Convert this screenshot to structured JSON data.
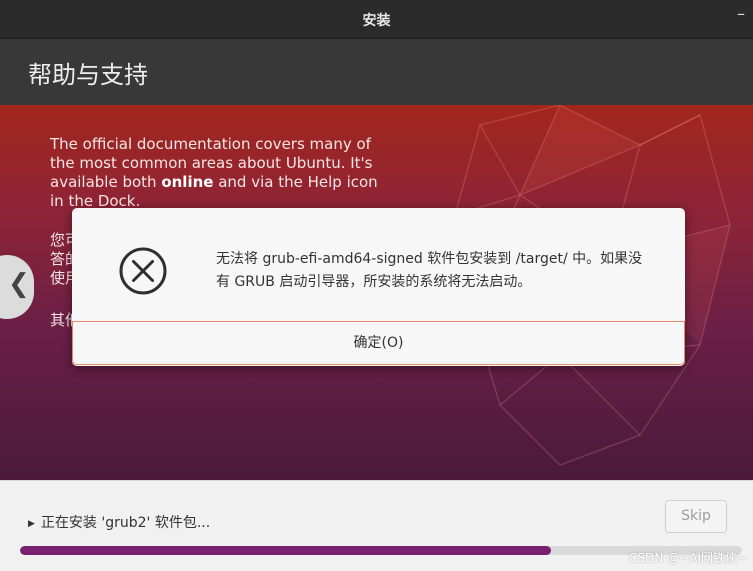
{
  "window": {
    "title": "安装",
    "minimize_glyph": "–"
  },
  "header": {
    "title": "帮助与支持"
  },
  "slide": {
    "paragraph_before_bold": "The official documentation covers many of the most common areas about Ubuntu. It's available both ",
    "bold_word": "online",
    "paragraph_after_bold": " and via the Help icon in the Dock.",
    "partial_lines": [
      "您可",
      "答的",
      "使用"
    ],
    "partial_line_last": "其他"
  },
  "nav": {
    "back_glyph": "❮"
  },
  "dialog": {
    "icon": "error-circle-x-icon",
    "message": "无法将 grub-efi-amd64-signed 软件包安装到 /target/ 中。如果没有 GRUB 启动引导器，所安装的系统将无法启动。",
    "ok_label": "确定(O)"
  },
  "progress": {
    "status_text": "正在安装 'grub2' 软件包...",
    "skip_label": "Skip",
    "fraction": 0.735
  },
  "watermark": {
    "text": "CSDN @~AI网铁侠~"
  }
}
